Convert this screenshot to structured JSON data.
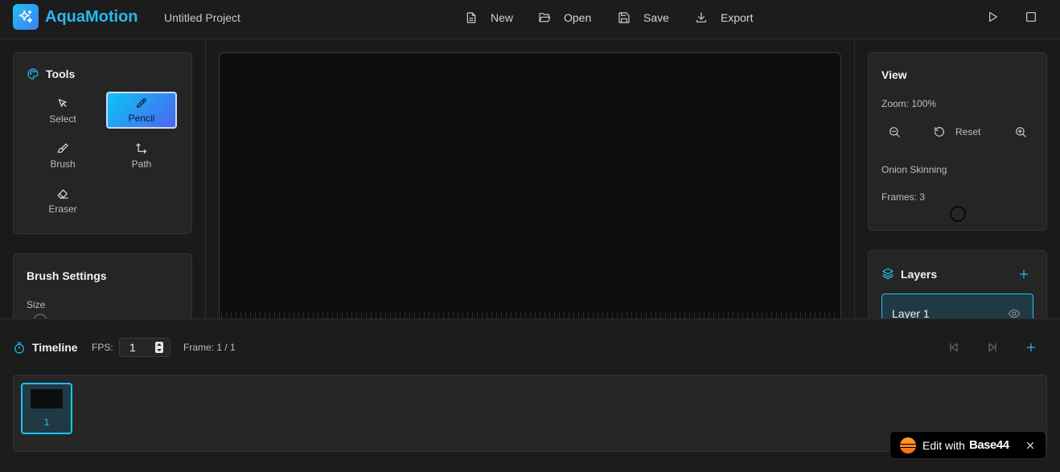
{
  "header": {
    "app_name": "AquaMotion",
    "project_name": "Untitled Project",
    "menu": [
      {
        "label": "New",
        "icon": "file-icon"
      },
      {
        "label": "Open",
        "icon": "folder-open-icon"
      },
      {
        "label": "Save",
        "icon": "save-icon"
      },
      {
        "label": "Export",
        "icon": "download-icon"
      }
    ],
    "actions": [
      "play-icon",
      "stop-icon"
    ]
  },
  "tools": {
    "title": "Tools",
    "items": [
      {
        "label": "Select",
        "icon": "cursor-icon",
        "active": false
      },
      {
        "label": "Pencil",
        "icon": "pencil-icon",
        "active": true
      },
      {
        "label": "Brush",
        "icon": "brush-icon",
        "active": false
      },
      {
        "label": "Path",
        "icon": "path-icon",
        "active": false
      },
      {
        "label": "Eraser",
        "icon": "eraser-icon",
        "active": false
      }
    ]
  },
  "brush_settings": {
    "title": "Brush Settings",
    "size_label": "Size"
  },
  "view": {
    "title": "View",
    "zoom_label": "Zoom: 100%",
    "reset_label": "Reset",
    "onion_label": "Onion Skinning",
    "frames_label": "Frames: 3"
  },
  "layers": {
    "title": "Layers",
    "items": [
      {
        "name": "Layer 1",
        "visible": true
      }
    ]
  },
  "timeline": {
    "title": "Timeline",
    "fps_label": "FPS:",
    "fps_value": "1",
    "frame_label": "Frame: 1 / 1",
    "frames": [
      {
        "number": "1"
      }
    ]
  },
  "badge": {
    "text": "Edit with",
    "brand": "Base44"
  },
  "colors": {
    "accent": "#29b8ef",
    "background": "#1a1a1a",
    "panel": "#252525"
  }
}
